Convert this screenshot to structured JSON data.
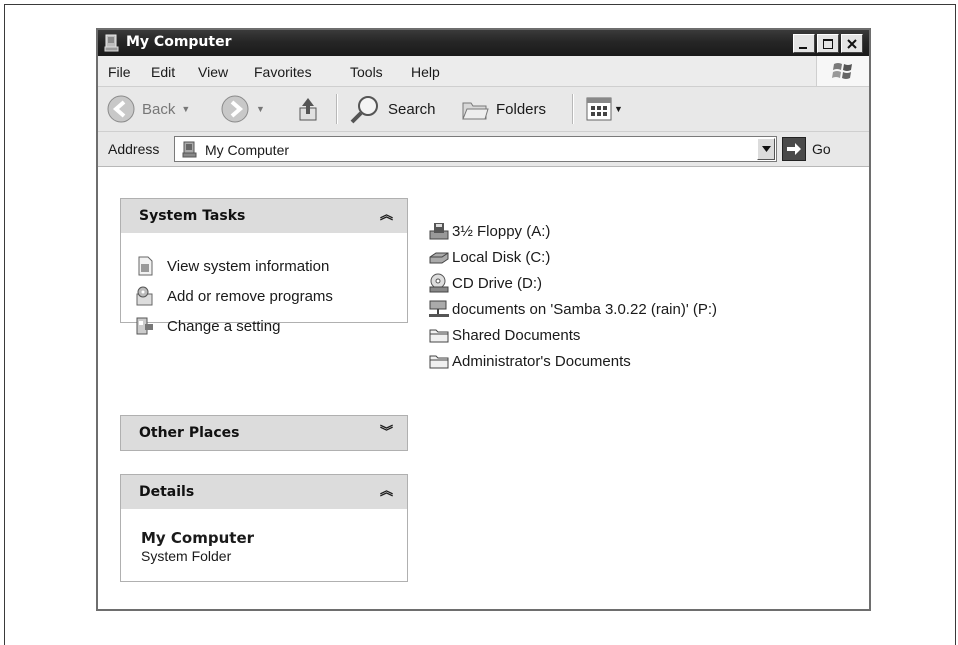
{
  "window": {
    "title": "My Computer"
  },
  "menu": [
    "File",
    "Edit",
    "View",
    "Favorites",
    "Tools",
    "Help"
  ],
  "toolbar": {
    "back_label": "Back",
    "search_label": "Search",
    "folders_label": "Folders"
  },
  "address": {
    "label": "Address",
    "value": "My Computer",
    "go_label": "Go"
  },
  "panels": {
    "system_tasks": {
      "title": "System Tasks",
      "items": [
        {
          "label": "View system information",
          "icon": "system-info-icon"
        },
        {
          "label": "Add or remove programs",
          "icon": "add-remove-programs-icon"
        },
        {
          "label": "Change a setting",
          "icon": "control-panel-icon"
        }
      ]
    },
    "other_places": {
      "title": "Other Places"
    },
    "details": {
      "title": "Details",
      "name": "My Computer",
      "type": "System Folder"
    }
  },
  "files": [
    {
      "label": "3½ Floppy (A:)",
      "icon": "floppy-drive-icon"
    },
    {
      "label": "Local Disk (C:)",
      "icon": "hard-disk-icon"
    },
    {
      "label": "CD Drive (D:)",
      "icon": "cd-drive-icon"
    },
    {
      "label": "documents on 'Samba 3.0.22 (rain)' (P:)",
      "icon": "network-drive-icon"
    },
    {
      "label": "Shared Documents",
      "icon": "folder-icon"
    },
    {
      "label": "Administrator's Documents",
      "icon": "folder-icon"
    }
  ]
}
